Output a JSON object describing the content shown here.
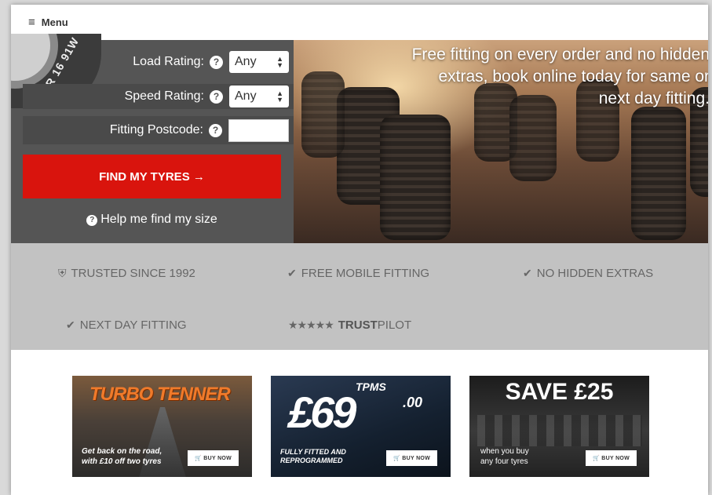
{
  "menu": {
    "icon": "hamburger-icon",
    "label": "Menu"
  },
  "tyre_image_text": "R 16 91W",
  "search": {
    "load_rating": {
      "label": "Load Rating:",
      "value": "Any"
    },
    "speed_rating": {
      "label": "Speed Rating:",
      "value": "Any"
    },
    "fitting_postcode": {
      "label": "Fitting Postcode:",
      "value": ""
    },
    "help_glyph": "?",
    "find_button": "FIND MY TYRES →",
    "help_link": "Help me find my size"
  },
  "hero": {
    "line1": "Free fitting on every order and no hidden",
    "line2": "extras, book online today for same or",
    "line3": "next day fitting."
  },
  "trust": {
    "trusted": "TRUSTED SINCE 1992",
    "free_fitting": "FREE MOBILE FITTING",
    "no_extras": "NO HIDDEN EXTRAS",
    "next_day": "NEXT DAY FITTING",
    "trust_bold": "TRUST",
    "trust_light": "PILOT",
    "stars": "★★★★★"
  },
  "offers": [
    {
      "title": "TURBO TENNER",
      "sub1": "Get back on the road,",
      "sub2": "with £10 off two tyres",
      "button": "BUY NOW"
    },
    {
      "title": "TPMS",
      "price": "£69",
      "cents": ".00",
      "sub1": "FULLY FITTED AND",
      "sub2": "REPROGRAMMED",
      "button": "BUY NOW"
    },
    {
      "title": "SAVE £25",
      "sub1": "when you buy",
      "sub2": "any four tyres",
      "button": "BUY NOW"
    }
  ],
  "colors": {
    "accent": "#d9140d",
    "panel": "#555555",
    "trust_bar": "#c2c2c2",
    "turbo_orange": "#f07a2a"
  }
}
